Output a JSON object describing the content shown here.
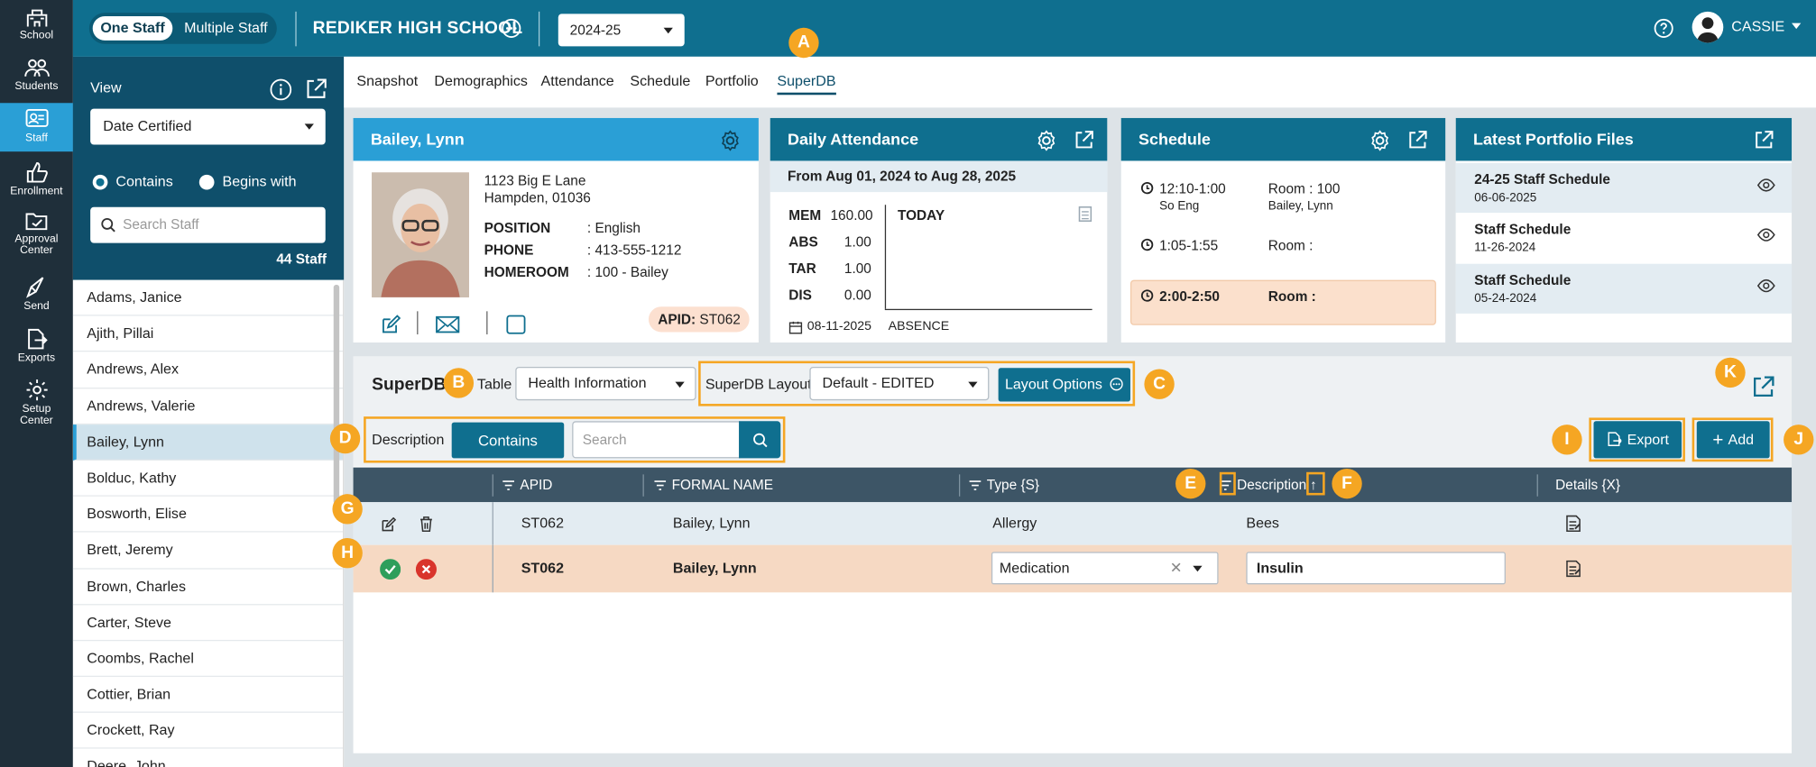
{
  "rail": [
    {
      "label": "School",
      "icon": "school-icon"
    },
    {
      "label": "Students",
      "icon": "students-icon"
    },
    {
      "label": "Staff",
      "icon": "staff-icon"
    },
    {
      "label": "Enrollment",
      "icon": "enrollment-icon"
    },
    {
      "label": "Approval Center",
      "icon": "approval-center-icon"
    },
    {
      "label": "Send",
      "icon": "send-icon"
    },
    {
      "label": "Exports",
      "icon": "exports-icon"
    },
    {
      "label": "Setup Center",
      "icon": "setup-center-icon"
    }
  ],
  "header": {
    "toggle_on": "One Staff",
    "toggle_off": "Multiple Staff",
    "school": "REDIKER HIGH SCHOOL",
    "year": "2024-25",
    "user": "CASSIE"
  },
  "left": {
    "view_label": "View",
    "view_value": "Date Certified",
    "contains": "Contains",
    "begins_with": "Begins with",
    "search_placeholder": "Search Staff",
    "count": "44 Staff",
    "staff": [
      "Adams, Janice",
      "Ajith, Pillai",
      "Andrews, Alex",
      "Andrews, Valerie",
      "Bailey, Lynn",
      "Bolduc, Kathy",
      "Bosworth, Elise",
      "Brett, Jeremy",
      "Brown, Charles",
      "Carter, Steve",
      "Coombs, Rachel",
      "Cottier, Brian",
      "Crockett, Ray",
      "Deere, John"
    ],
    "selected_index": 4
  },
  "tabs": [
    "Snapshot",
    "Demographics",
    "Attendance",
    "Schedule",
    "Portfolio",
    "SuperDB"
  ],
  "profile": {
    "name": "Bailey, Lynn",
    "address1": "1123 Big E Lane",
    "address2": "Hampden, 01036",
    "position_label": "POSITION",
    "position_value": ": English",
    "phone_label": "PHONE",
    "phone_value": ": 413-555-1212",
    "homeroom_label": "HOMEROOM",
    "homeroom_value": ": 100 - Bailey",
    "apid_label": "APID:",
    "apid_value": "ST062"
  },
  "attendance": {
    "title": "Daily Attendance",
    "range": "From Aug 01, 2024 to Aug 28, 2025",
    "rows": [
      {
        "k": "MEM",
        "v": "160.00"
      },
      {
        "k": "ABS",
        "v": "1.00"
      },
      {
        "k": "TAR",
        "v": "1.00"
      },
      {
        "k": "DIS",
        "v": "0.00"
      }
    ],
    "today": "TODAY",
    "date": "08-11-2025",
    "absence": "ABSENCE"
  },
  "schedule": {
    "title": "Schedule",
    "rows": [
      {
        "time": "12:10-1:00",
        "sub": "So Eng",
        "room": "Room : 100",
        "teacher": "Bailey, Lynn"
      },
      {
        "time": "1:05-1:55",
        "sub": "",
        "room": "Room :",
        "teacher": ""
      },
      {
        "time": "2:00-2:50",
        "sub": "",
        "room": "Room :",
        "teacher": ""
      }
    ]
  },
  "portfolio": {
    "title": "Latest Portfolio Files",
    "files": [
      {
        "name": "24-25 Staff Schedule",
        "date": "06-06-2025"
      },
      {
        "name": "Staff Schedule",
        "date": "11-26-2024"
      },
      {
        "name": "Staff Schedule",
        "date": "05-24-2024"
      }
    ]
  },
  "superdb": {
    "title": "SuperDB",
    "table_label": "Table",
    "table_value": "Health Information",
    "layout_label": "SuperDB Layout",
    "layout_value": "Default - EDITED",
    "layout_options": "Layout Options",
    "filter_field": "Description",
    "filter_mode": "Contains",
    "search_placeholder": "Search",
    "export": "Export",
    "add": "Add",
    "columns": [
      "APID",
      "FORMAL NAME",
      "Type {S}",
      "Description",
      "Details {X}"
    ],
    "row1": {
      "apid": "ST062",
      "name": "Bailey, Lynn",
      "type": "Allergy",
      "desc": "Bees"
    },
    "row2": {
      "apid": "ST062",
      "name": "Bailey, Lynn",
      "type": "Medication",
      "desc": "Insulin"
    }
  },
  "markers": [
    "A",
    "B",
    "C",
    "D",
    "E",
    "F",
    "G",
    "H",
    "I",
    "J",
    "K"
  ],
  "colors": {
    "accent": "#f5a623",
    "header": "#0f6f8f",
    "card_blue": "#2a9fd6",
    "edit_row": "#f6d9c3"
  }
}
